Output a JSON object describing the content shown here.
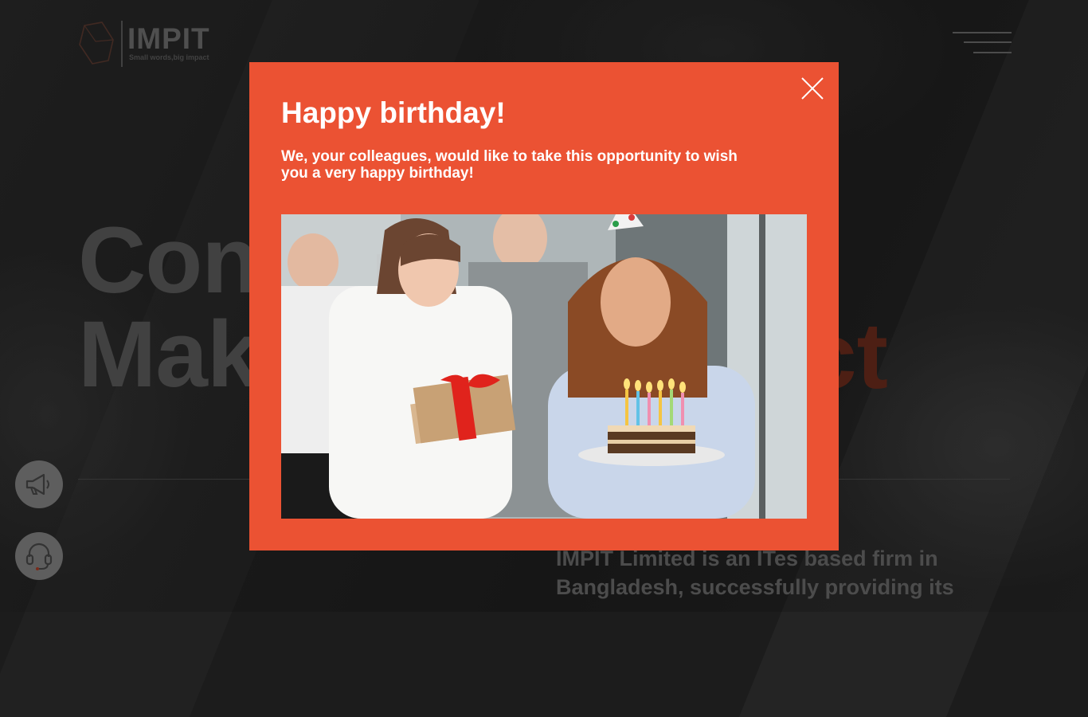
{
  "background": {
    "logo": {
      "name": "IMPIT",
      "tagline": "Small words,big impact"
    },
    "hero": {
      "line1": "Con",
      "line2": "Mak",
      "accent_fragment": "ct"
    },
    "about_text": "IMPIT Limited is an ITes based firm in Bangladesh, successfully providing its",
    "menu_icon": "hamburger-menu-icon",
    "floating_buttons": [
      {
        "icon": "megaphone-icon"
      },
      {
        "icon": "headset-icon"
      }
    ]
  },
  "modal": {
    "title": "Happy birthday!",
    "message": "We, your colleagues, would like to take this opportunity to wish you a very happy birthday!",
    "close_icon": "close-icon",
    "background_color": "#eb5233",
    "photo_alt": "Colleagues celebrating with a gift and a birthday cake with candles"
  },
  "colors": {
    "accent": "#eb5233",
    "overlay": "#1c1c1c",
    "text_on_accent": "#ffffff"
  }
}
